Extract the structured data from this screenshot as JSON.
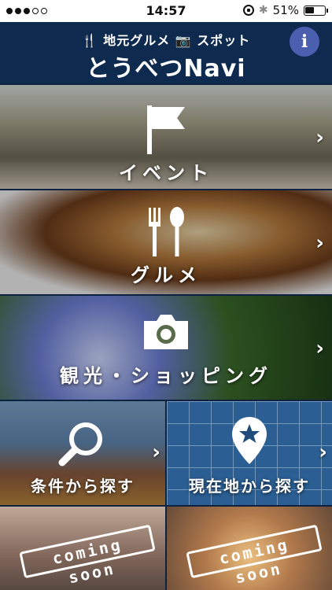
{
  "status_bar": {
    "signal_dots": 5,
    "signal_filled": 3,
    "time": "14:57",
    "battery_text": "51%",
    "battery_level": 0.51
  },
  "header": {
    "subtitle": "🍴 地元グルメ 📷 スポット",
    "title": "とうべつNavi",
    "info_icon_char": "i"
  },
  "tiles": {
    "event": {
      "label": "イベント",
      "icon": "flag-icon"
    },
    "gourmet": {
      "label": "グルメ",
      "icon": "fork-spoon-icon"
    },
    "sightseeing": {
      "label": "観光・ショッピング",
      "icon": "camera-icon"
    },
    "search": {
      "label": "条件から探す",
      "icon": "magnifier-icon"
    },
    "current_location": {
      "label": "現在地から探す",
      "icon": "location-pin-icon"
    },
    "coming_soon_1": {
      "stamp": "coming soon"
    },
    "coming_soon_2": {
      "stamp": "coming soon"
    }
  },
  "chevron": "›",
  "colors": {
    "header_bg": "#0f2a4f",
    "info_button": "#4a5fb0",
    "background": "#0d2240"
  }
}
